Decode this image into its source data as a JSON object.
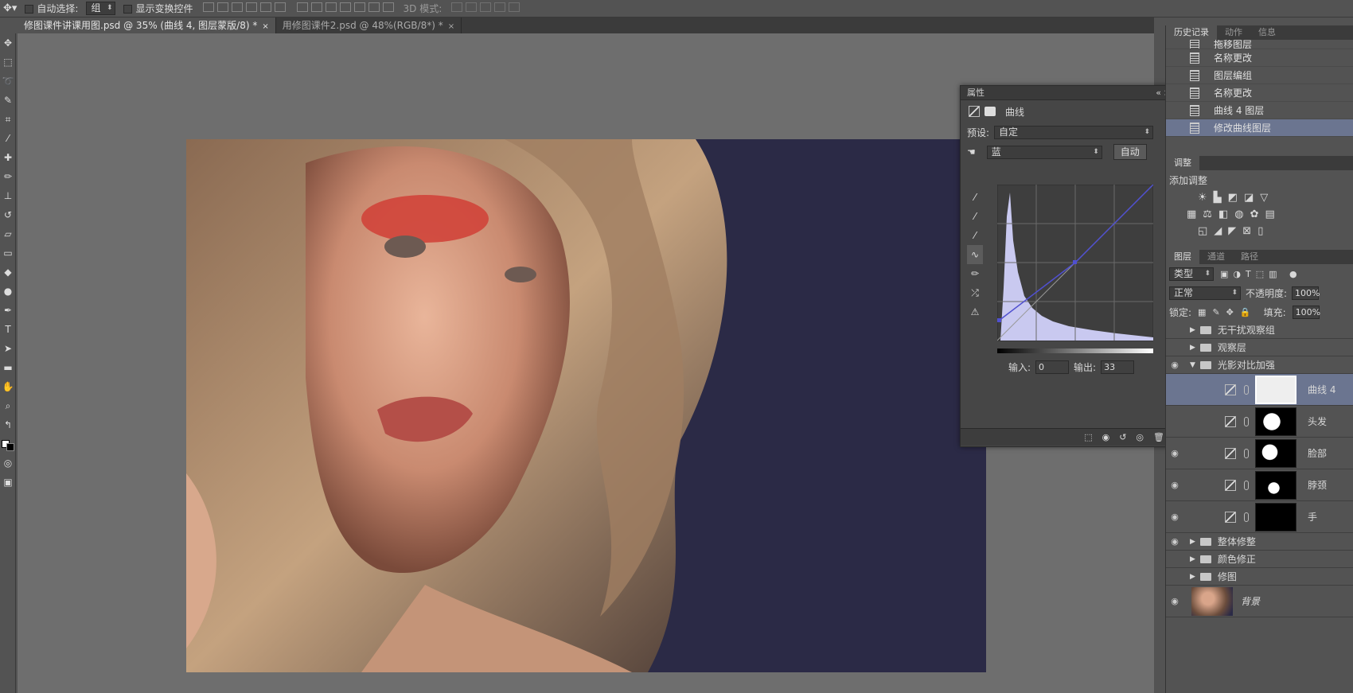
{
  "options_bar": {
    "auto_select_label": "自动选择:",
    "auto_select_value": "组",
    "show_transform_label": "显示变换控件",
    "mode_3d_label": "3D 模式:"
  },
  "tabs": [
    {
      "label": "修图课件讲课用图.psd @ 35% (曲线 4, 图层蒙版/8) *",
      "close": "×"
    },
    {
      "label": "用修图课件2.psd @ 48%(RGB/8*) *",
      "close": "×"
    }
  ],
  "right_panel": {
    "history_tabs": [
      "历史记录",
      "动作",
      "信息"
    ],
    "history_items": [
      {
        "label": "拖移图层"
      },
      {
        "label": "名称更改"
      },
      {
        "label": "图层编组"
      },
      {
        "label": "名称更改"
      },
      {
        "label": "曲线 4 图层"
      },
      {
        "label": "修改曲线图层"
      }
    ],
    "adjust_tab": "调整",
    "adjust_title": "添加调整",
    "layer_tabs": [
      "图层",
      "通道",
      "路径"
    ],
    "layer_filter": "类型",
    "blend_mode": "正常",
    "opacity_label": "不透明度:",
    "opacity_value": "100%",
    "lock_label": "锁定:",
    "fill_label": "填充:",
    "fill_value": "100%",
    "groups_top": [
      {
        "name": "无干扰观察组"
      },
      {
        "name": "观察层"
      },
      {
        "name": "光影对比加强"
      }
    ],
    "layers": [
      {
        "name": "曲线 4"
      },
      {
        "name": "头发"
      },
      {
        "name": "脸部"
      },
      {
        "name": "脖颈"
      },
      {
        "name": "手"
      }
    ],
    "groups_bottom": [
      {
        "name": "整体修整"
      },
      {
        "name": "颜色修正"
      },
      {
        "name": "修图"
      }
    ],
    "background_name": "背景"
  },
  "properties": {
    "header": "属性",
    "title": "曲线",
    "preset_label": "预设:",
    "preset_value": "自定",
    "channel_value": "蓝",
    "auto_button": "自动",
    "input_label": "输入:",
    "input_value": "0",
    "output_label": "输出:",
    "output_value": "33"
  },
  "colors": {
    "panel": "#535353",
    "dark": "#3b3b3b",
    "canvas": "#6e6e6e",
    "selection": "#6b7590",
    "curve_hist": "#c9c9f0",
    "curve_line": "#5050d0"
  }
}
